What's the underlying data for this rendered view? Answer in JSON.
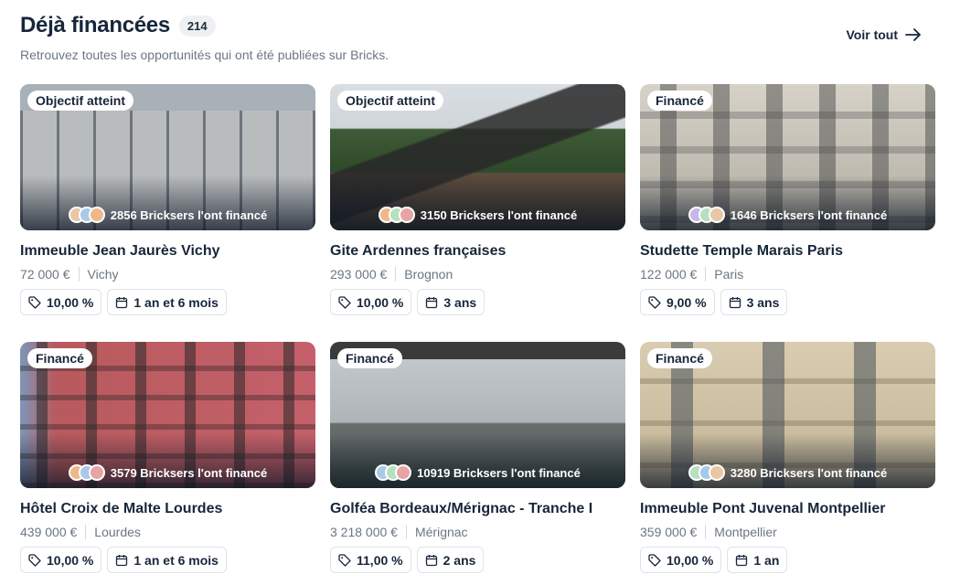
{
  "header": {
    "title": "Déjà financées",
    "count": "214",
    "subtitle": "Retrouvez toutes les opportunités qui ont été publiées sur Bricks.",
    "see_all": "Voir tout"
  },
  "icons": {
    "see_all": "arrow-right-icon",
    "rate": "tag-percent-icon",
    "duration": "calendar-icon"
  },
  "cards": [
    {
      "status": "Objectif atteint",
      "backers": "2856 Bricksers l'ont financé",
      "name": "Immeuble Jean Jaurès Vichy",
      "amount": "72 000 €",
      "city": "Vichy",
      "rate": "10,00 %",
      "duration": "1 an et 6 mois"
    },
    {
      "status": "Objectif atteint",
      "backers": "3150 Bricksers l'ont financé",
      "name": "Gite Ardennes françaises",
      "amount": "293 000 €",
      "city": "Brognon",
      "rate": "10,00 %",
      "duration": "3 ans"
    },
    {
      "status": "Financé",
      "backers": "1646 Bricksers l'ont financé",
      "name": "Studette Temple Marais Paris",
      "amount": "122 000 €",
      "city": "Paris",
      "rate": "9,00 %",
      "duration": "3 ans"
    },
    {
      "status": "Financé",
      "backers": "3579 Bricksers l'ont financé",
      "name": "Hôtel Croix de Malte Lourdes",
      "amount": "439 000 €",
      "city": "Lourdes",
      "rate": "10,00 %",
      "duration": "1 an et 6 mois"
    },
    {
      "status": "Financé",
      "backers": "10919 Bricksers l'ont financé",
      "name": "Golféa Bordeaux/Mérignac - Tranche I",
      "amount": "3 218 000 €",
      "city": "Mérignac",
      "rate": "11,00 %",
      "duration": "2 ans"
    },
    {
      "status": "Financé",
      "backers": "3280 Bricksers l'ont financé",
      "name": "Immeuble Pont Juvenal Montpellier",
      "amount": "359 000 €",
      "city": "Montpellier",
      "rate": "10,00 %",
      "duration": "1 an"
    }
  ]
}
